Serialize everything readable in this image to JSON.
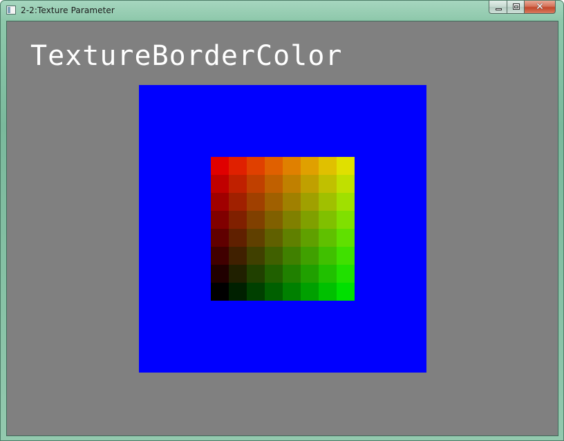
{
  "window": {
    "title": "2-2:Texture Parameter",
    "close_glyph": "✕"
  },
  "client": {
    "heading": "TextureBorderColor",
    "background_color": "#808080",
    "border_color": "#0000ff",
    "texture": {
      "rows": 8,
      "cols": 8,
      "description_colors": {
        "top_left": "#e00000",
        "top_right": "#e0e000",
        "bottom_left": "#000000",
        "bottom_right": "#00e000"
      }
    }
  }
}
